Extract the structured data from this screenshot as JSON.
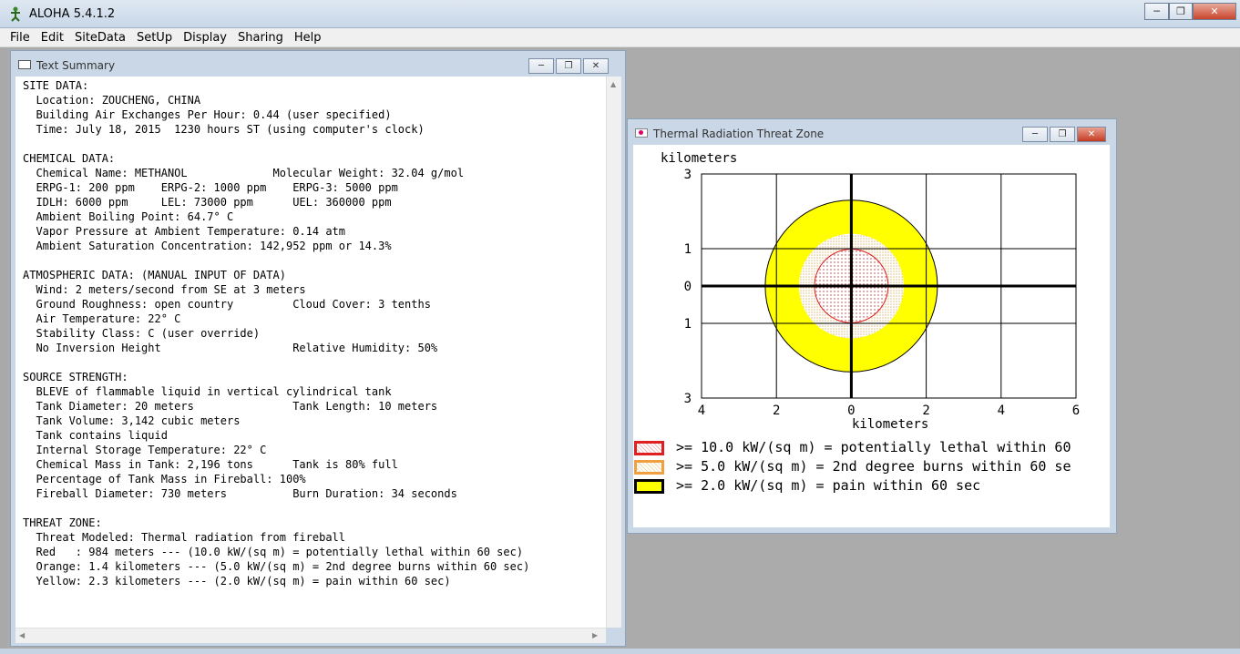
{
  "app": {
    "title": "ALOHA 5.4.1.2",
    "menu": [
      "File",
      "Edit",
      "SiteData",
      "SetUp",
      "Display",
      "Sharing",
      "Help"
    ]
  },
  "text_summary": {
    "title": "Text Summary",
    "lines": [
      "SITE DATA:",
      "  Location: ZOUCHENG, CHINA",
      "  Building Air Exchanges Per Hour: 0.44 (user specified)",
      "  Time: July 18, 2015  1230 hours ST (using computer's clock)",
      "",
      "CHEMICAL DATA:",
      "  Chemical Name: METHANOL             Molecular Weight: 32.04 g/mol",
      "  ERPG-1: 200 ppm    ERPG-2: 1000 ppm    ERPG-3: 5000 ppm",
      "  IDLH: 6000 ppm     LEL: 73000 ppm      UEL: 360000 ppm",
      "  Ambient Boiling Point: 64.7° C",
      "  Vapor Pressure at Ambient Temperature: 0.14 atm",
      "  Ambient Saturation Concentration: 142,952 ppm or 14.3%",
      "",
      "ATMOSPHERIC DATA: (MANUAL INPUT OF DATA)",
      "  Wind: 2 meters/second from SE at 3 meters",
      "  Ground Roughness: open country         Cloud Cover: 3 tenths",
      "  Air Temperature: 22° C",
      "  Stability Class: C (user override)",
      "  No Inversion Height                    Relative Humidity: 50%",
      "",
      "SOURCE STRENGTH:",
      "  BLEVE of flammable liquid in vertical cylindrical tank",
      "  Tank Diameter: 20 meters               Tank Length: 10 meters",
      "  Tank Volume: 3,142 cubic meters",
      "  Tank contains liquid",
      "  Internal Storage Temperature: 22° C",
      "  Chemical Mass in Tank: 2,196 tons      Tank is 80% full",
      "  Percentage of Tank Mass in Fireball: 100%",
      "  Fireball Diameter: 730 meters          Burn Duration: 34 seconds",
      "",
      "THREAT ZONE:",
      "  Threat Modeled: Thermal radiation from fireball",
      "  Red   : 984 meters --- (10.0 kW/(sq m) = potentially lethal within 60 sec)",
      "  Orange: 1.4 kilometers --- (5.0 kW/(sq m) = 2nd degree burns within 60 sec)",
      "  Yellow: 2.3 kilometers --- (2.0 kW/(sq m) = pain within 60 sec)"
    ]
  },
  "threat_zone": {
    "title": "Thermal Radiation Threat Zone",
    "y_unit": "kilometers",
    "x_unit": "kilometers",
    "y_ticks": [
      "3",
      "1",
      "0",
      "1",
      "3"
    ],
    "x_ticks": [
      "4",
      "2",
      "0",
      "2",
      "4",
      "6"
    ],
    "zones_km": {
      "red": 0.984,
      "orange": 1.4,
      "yellow": 2.3
    },
    "colors": {
      "red": "#e02020",
      "orange": "#f0a040",
      "yellow": "#ffff00"
    },
    "legend": [
      ">= 10.0 kW/(sq m) = potentially lethal within 60",
      ">= 5.0 kW/(sq m) = 2nd degree burns within 60 se",
      ">= 2.0 kW/(sq m) = pain within 60 sec"
    ]
  }
}
